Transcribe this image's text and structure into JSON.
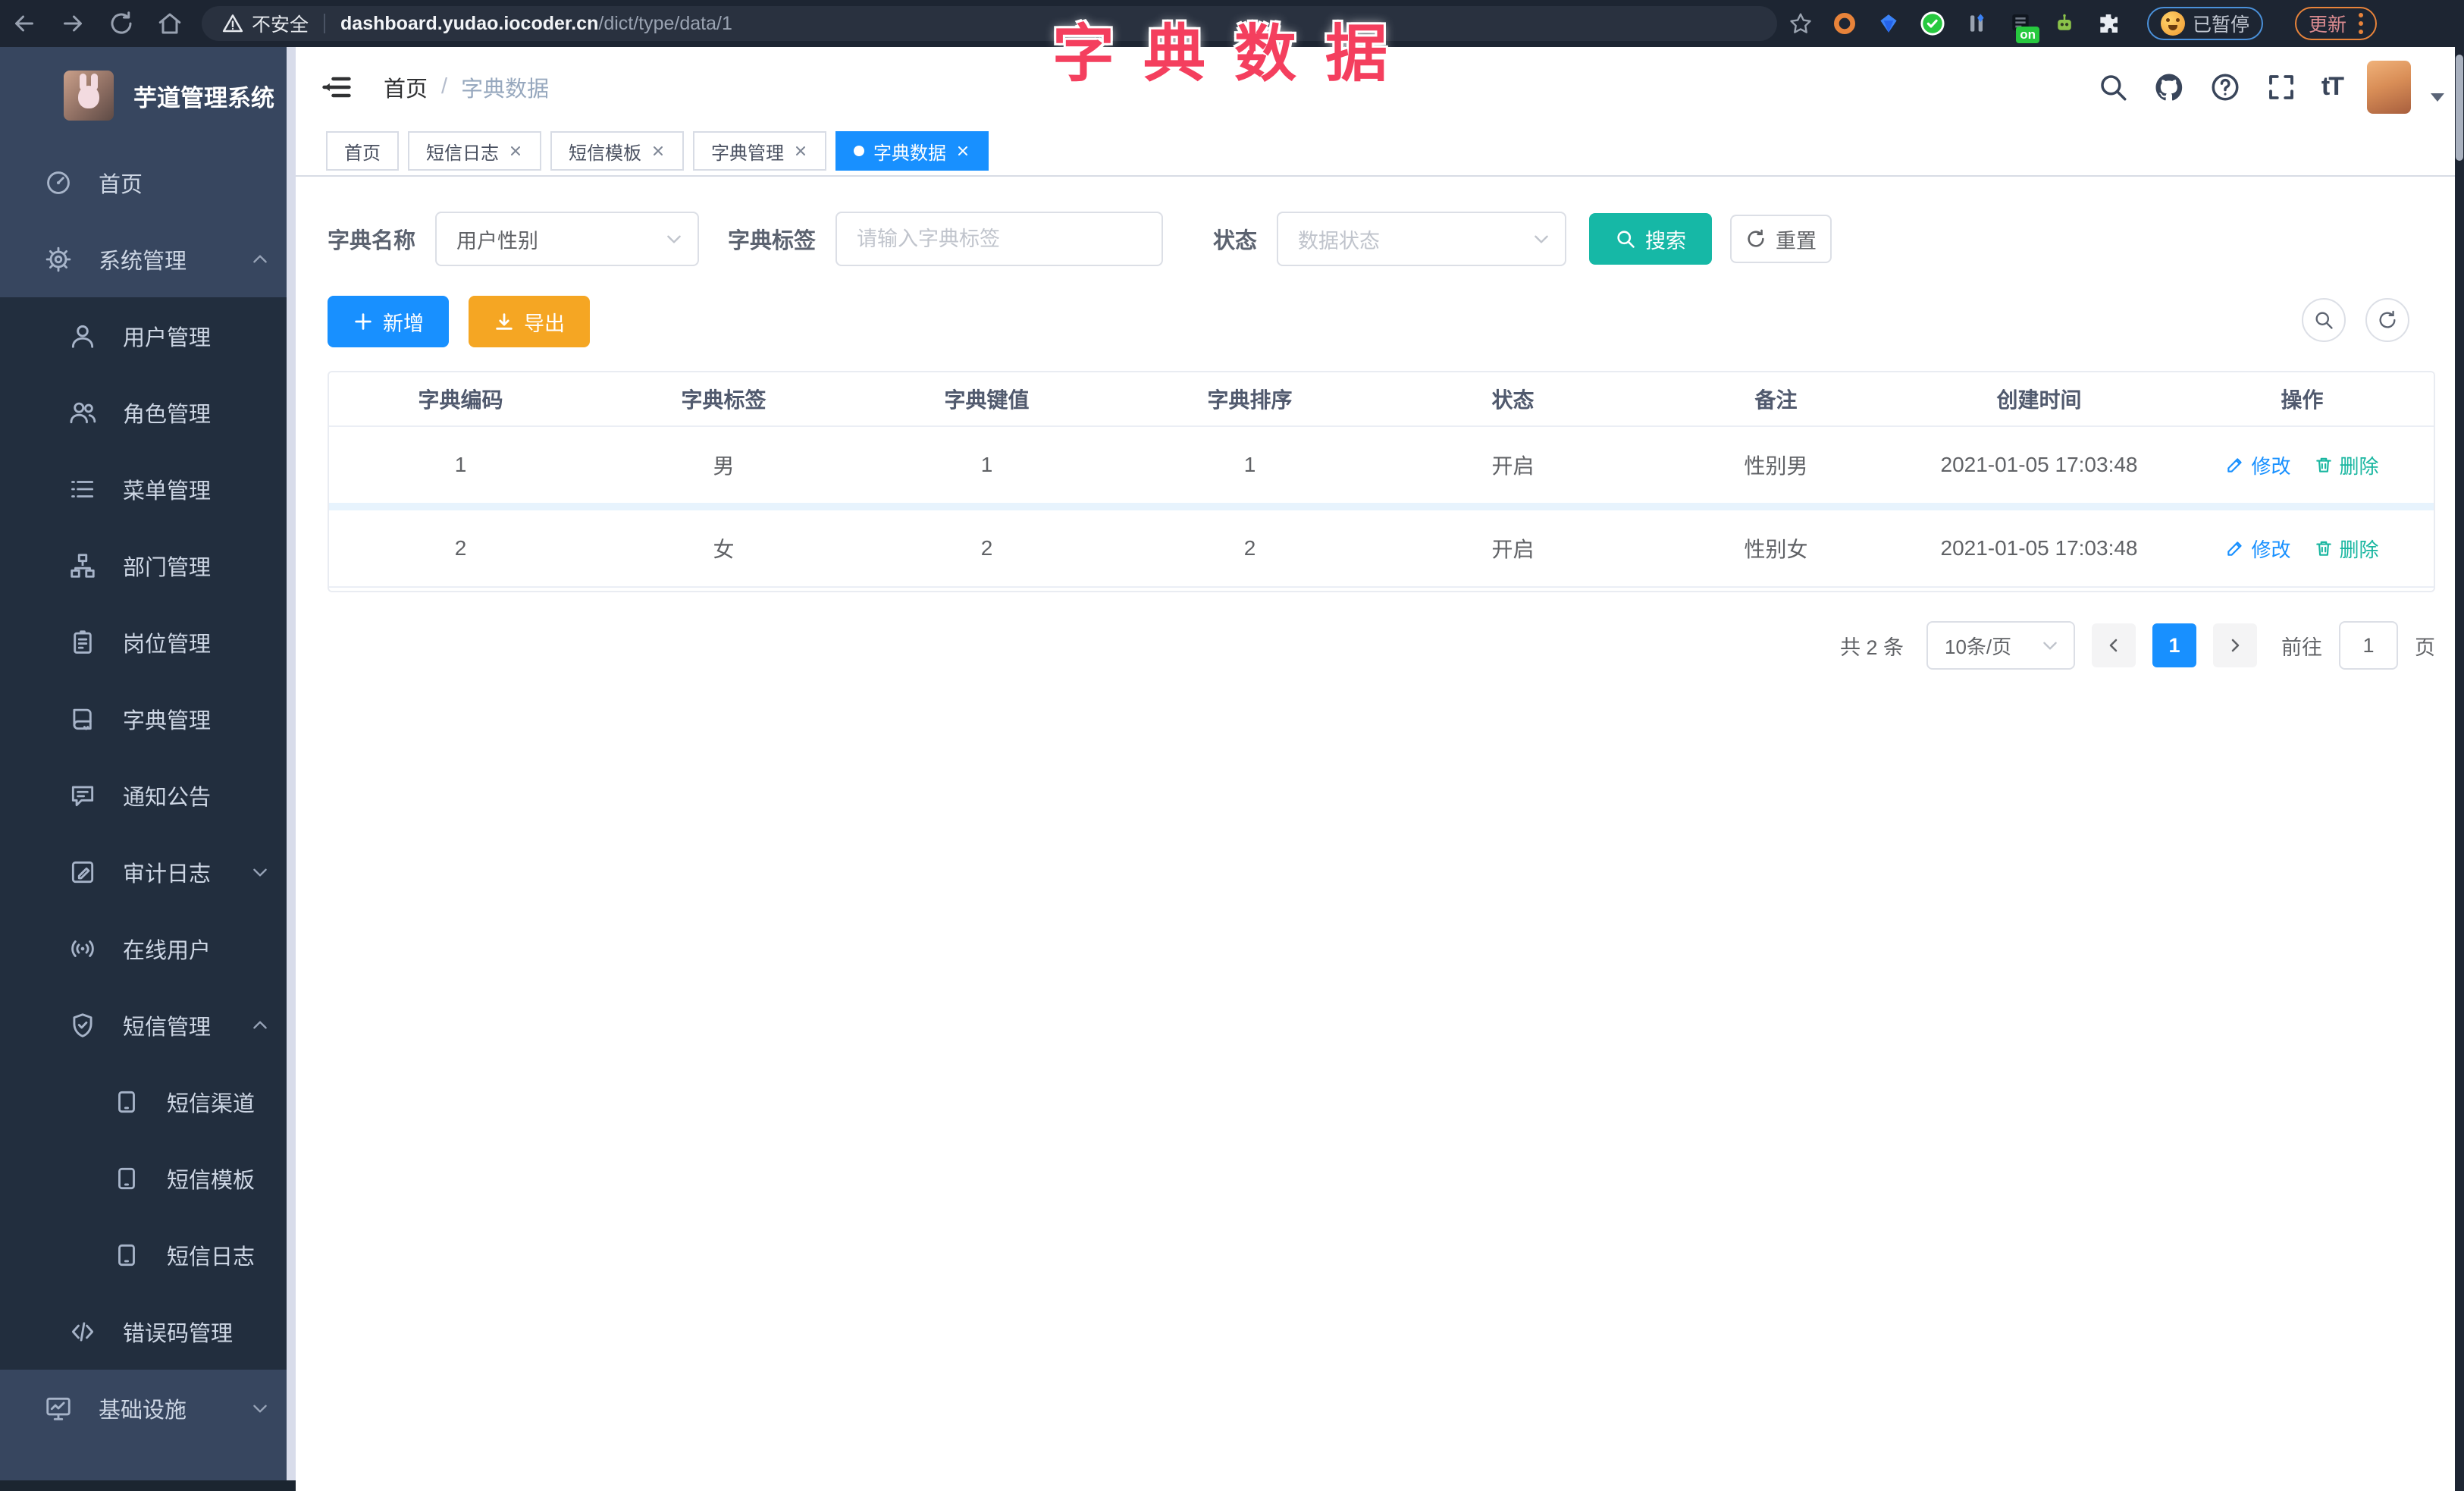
{
  "browser": {
    "security_label": "不安全",
    "url_host": "dashboard.yudao.iocoder.cn",
    "url_path": "/dict/type/data/1",
    "extension_on_badge": "on",
    "paused_label": "已暂停",
    "update_label": "更新"
  },
  "overlay": {
    "title": "字典数据",
    "color": "#f43f5e"
  },
  "sidebar": {
    "logo_title": "芋道管理系统",
    "items": [
      {
        "label": "首页"
      },
      {
        "label": "系统管理"
      },
      {
        "label": "用户管理"
      },
      {
        "label": "角色管理"
      },
      {
        "label": "菜单管理"
      },
      {
        "label": "部门管理"
      },
      {
        "label": "岗位管理"
      },
      {
        "label": "字典管理"
      },
      {
        "label": "通知公告"
      },
      {
        "label": "审计日志"
      },
      {
        "label": "在线用户"
      },
      {
        "label": "短信管理"
      },
      {
        "label": "短信渠道"
      },
      {
        "label": "短信模板"
      },
      {
        "label": "短信日志"
      },
      {
        "label": "错误码管理"
      },
      {
        "label": "基础设施"
      }
    ]
  },
  "header": {
    "breadcrumb_home": "首页",
    "breadcrumb_sep": "/",
    "breadcrumb_current": "字典数据",
    "font_size_glyph": "tT"
  },
  "tabs": [
    {
      "label": "首页"
    },
    {
      "label": "短信日志"
    },
    {
      "label": "短信模板"
    },
    {
      "label": "字典管理"
    },
    {
      "label": "字典数据"
    }
  ],
  "filters": {
    "name_label": "字典名称",
    "name_value": "用户性别",
    "tag_label": "字典标签",
    "tag_placeholder": "请输入字典标签",
    "status_label": "状态",
    "status_placeholder": "数据状态",
    "search_label": "搜索",
    "reset_label": "重置"
  },
  "toolbar": {
    "add_label": "新增",
    "export_label": "导出"
  },
  "table": {
    "columns": [
      "字典编码",
      "字典标签",
      "字典键值",
      "字典排序",
      "状态",
      "备注",
      "创建时间",
      "操作"
    ],
    "rows": [
      [
        "1",
        "男",
        "1",
        "1",
        "开启",
        "性别男",
        "2021-01-05 17:03:48"
      ],
      [
        "2",
        "女",
        "2",
        "2",
        "开启",
        "性别女",
        "2021-01-05 17:03:48"
      ]
    ],
    "action_edit": "修改",
    "action_delete": "删除"
  },
  "pagination": {
    "total": "共 2 条",
    "page_size": "10条/页",
    "current": "1",
    "goto_label": "前往",
    "goto_value": "1",
    "page_label": "页"
  },
  "colors": {
    "accent_blue": "#1890ff",
    "teal": "#16b8a6",
    "orange": "#f5a623",
    "title_red": "#f43f5e",
    "sidebar_bg": "#37465f",
    "submenu_bg": "#222e3e"
  }
}
